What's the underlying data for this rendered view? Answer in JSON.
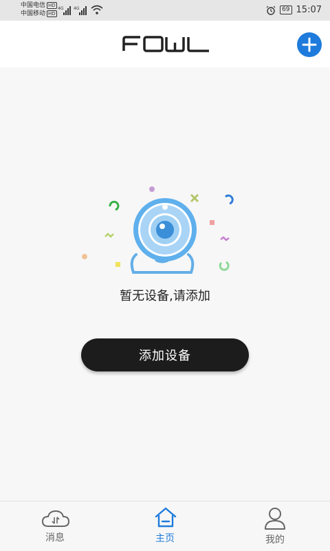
{
  "status_bar": {
    "carrier1": "中国电信",
    "carrier2": "中国移动",
    "hd_badge": "HD",
    "network": "4G",
    "battery": "69",
    "time": "15:07"
  },
  "header": {
    "logo_text": "FOWL",
    "add_icon": "plus-circle-icon",
    "accent": "#1e7bdc"
  },
  "empty_state": {
    "message": "暂无设备,请添加",
    "illustration_icon": "webcam-icon"
  },
  "add_device_button": {
    "label": "添加设备"
  },
  "tabs": [
    {
      "label": "消息",
      "icon": "cloud-icon",
      "active": false
    },
    {
      "label": "主页",
      "icon": "home-icon",
      "active": true
    },
    {
      "label": "我的",
      "icon": "user-icon",
      "active": false
    }
  ],
  "colors": {
    "active_tab": "#1e7bdc",
    "inactive_tab": "#666666",
    "button_bg": "#1c1c1c"
  }
}
